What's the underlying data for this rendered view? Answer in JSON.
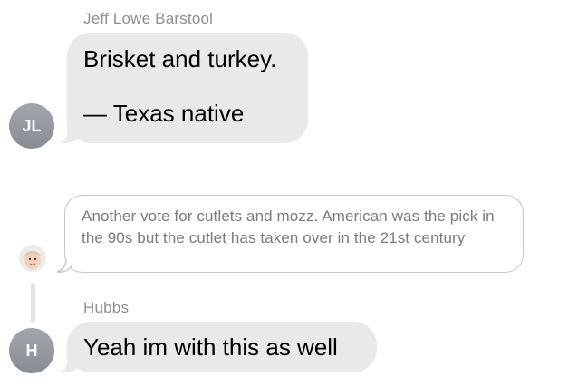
{
  "messages": [
    {
      "sender": "Jeff  Lowe Barstool",
      "lines": [
        "Brisket and turkey.",
        "",
        "— Texas native"
      ],
      "avatar_initials": "JL"
    },
    {
      "reply_quote": "Another vote for cutlets and mozz. American was the pick in the 90s but the cutlet has taken over in the 21st century",
      "reply_avatar": "memoji-icon"
    },
    {
      "sender": "Hubbs",
      "text": "Yeah im with this as well",
      "avatar_initials": "H"
    }
  ],
  "colors": {
    "bubble_bg": "#e9e9eb",
    "sender_text": "#8e8e93",
    "avatar_bg": "#9a9ca4",
    "reply_border": "#c7c7cc"
  }
}
